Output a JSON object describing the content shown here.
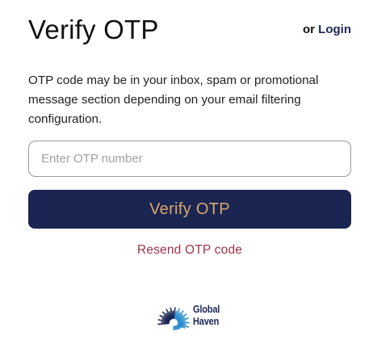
{
  "header": {
    "title": "Verify OTP",
    "or_text": "or",
    "login_label": "Login"
  },
  "description": "OTP code may be in your inbox, spam or promotional message section depending on your email filtering configuration.",
  "form": {
    "otp_placeholder": "Enter OTP number",
    "otp_value": "",
    "verify_label": "Verify OTP",
    "resend_label": "Resend OTP code"
  },
  "logo": {
    "line1": "Global",
    "line2": "Haven",
    "icon": "sunburst-icon"
  },
  "colors": {
    "primary_button": "#1b2552",
    "button_text": "#d9a86a",
    "resend_link": "#9c3447",
    "logo_navy": "#1c2754",
    "logo_blue": "#2f8fd0"
  }
}
